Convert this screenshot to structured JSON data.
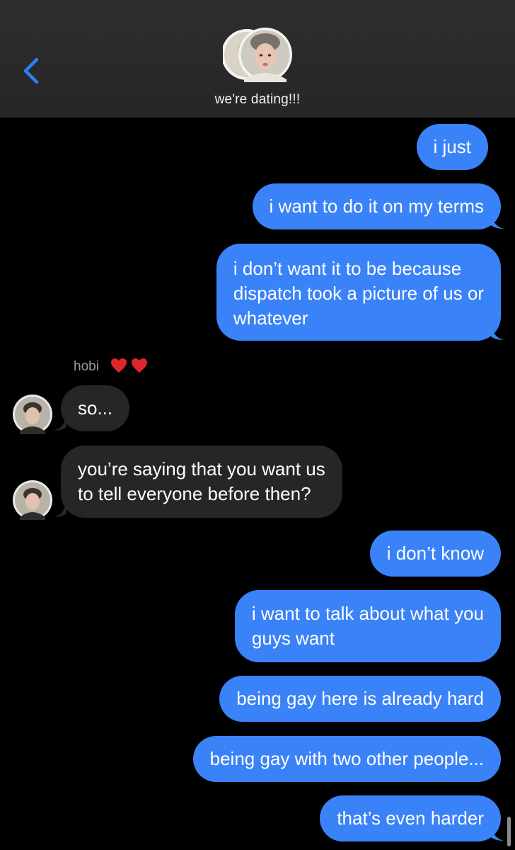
{
  "header": {
    "group_name": "we're dating!!!",
    "back_icon": "chevron-left-icon",
    "accent": "#2f80f6"
  },
  "colors": {
    "outgoing_bubble": "#3a82f7",
    "incoming_bubble": "#262629",
    "background": "#000000",
    "heart": "#e0262d"
  },
  "sender": {
    "name": "hobi",
    "emoji": "❤️❤️"
  },
  "messages": [
    {
      "direction": "out",
      "lines": [
        "i just"
      ]
    },
    {
      "direction": "out",
      "lines": [
        "i want to do it on my terms"
      ]
    },
    {
      "direction": "out",
      "lines": [
        "i don’t want it to be because",
        "dispatch took a picture of us or",
        "whatever"
      ]
    },
    {
      "direction": "in",
      "lines": [
        "so..."
      ]
    },
    {
      "direction": "in",
      "lines": [
        "you’re saying that you want us",
        "to tell everyone before then?"
      ]
    },
    {
      "direction": "out",
      "lines": [
        "i don’t know"
      ]
    },
    {
      "direction": "out",
      "lines": [
        "i want to talk about what you",
        "guys want"
      ]
    },
    {
      "direction": "out",
      "lines": [
        "being gay here is already hard"
      ]
    },
    {
      "direction": "out",
      "lines": [
        "being gay with two other people..."
      ]
    },
    {
      "direction": "out",
      "lines": [
        "that’s even harder"
      ]
    }
  ]
}
